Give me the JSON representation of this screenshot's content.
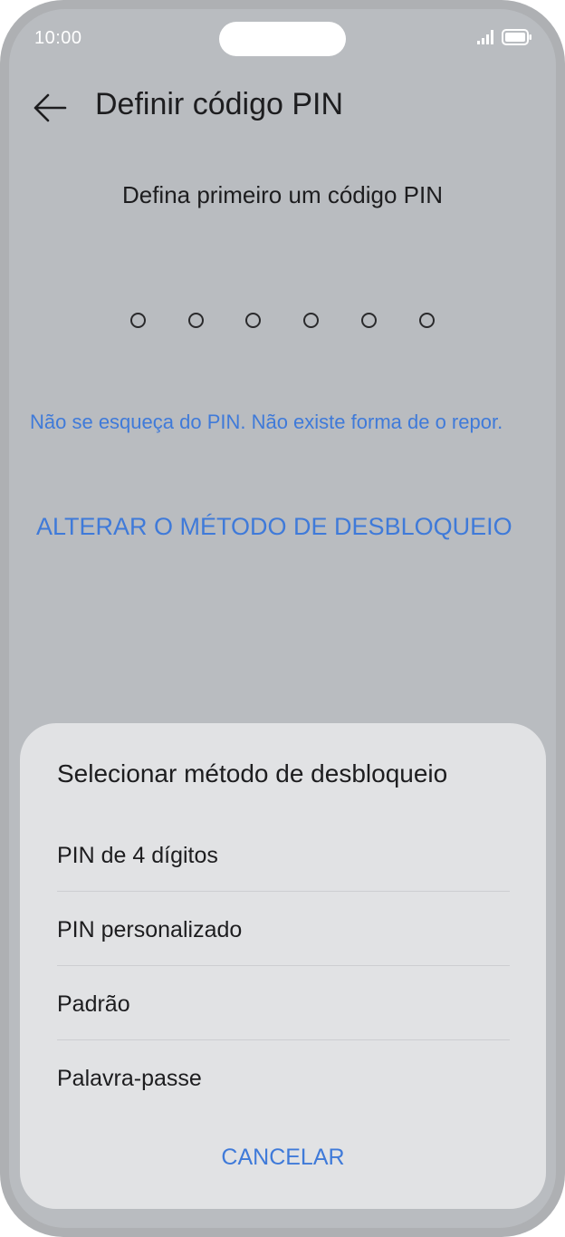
{
  "status_bar": {
    "time": "10:00",
    "signal_icon": "signal-icon",
    "battery_icon": "battery-icon"
  },
  "header": {
    "back_icon": "back-arrow-icon",
    "title": "Definir código PIN"
  },
  "main": {
    "prompt": "Defina primeiro um código PIN",
    "pin_length": 6,
    "pin_entered": 0,
    "warning": "Não se esqueça do PIN. Não existe forma de o repor.",
    "change_method_link": "ALTERAR O MÉTODO DE DESBLOQUEIO"
  },
  "sheet": {
    "title": "Selecionar método de desbloqueio",
    "options": [
      {
        "label": "PIN de 4 dígitos"
      },
      {
        "label": "PIN personalizado"
      },
      {
        "label": "Padrão"
      },
      {
        "label": "Palavra-passe"
      }
    ],
    "cancel_label": "CANCELAR"
  },
  "colors": {
    "accent": "#3f7ad9",
    "text_primary": "#1d1d1f",
    "screen_background": "#b9bcc0",
    "sheet_background": "#e1e2e4",
    "frame": "#aeb0b3"
  }
}
